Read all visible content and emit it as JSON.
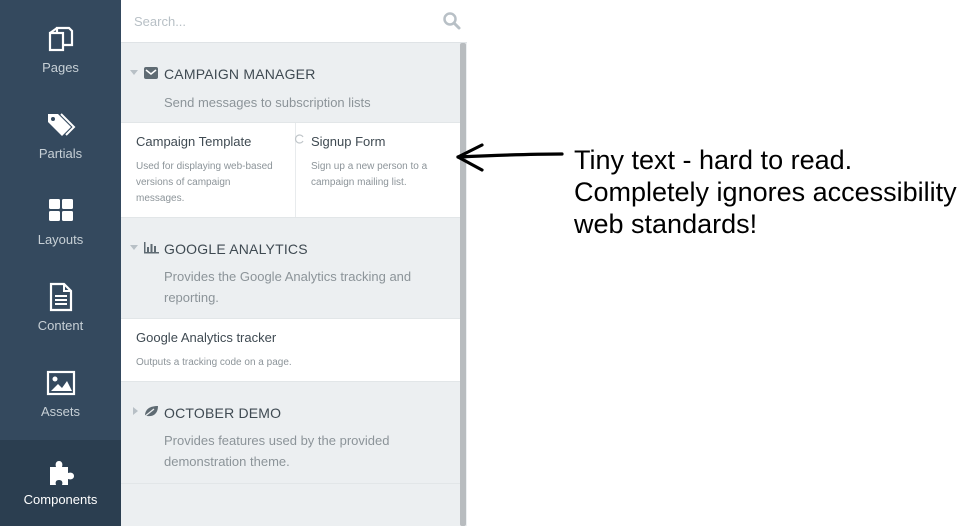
{
  "nav": {
    "items": [
      {
        "label": "Pages",
        "icon": "pages-icon"
      },
      {
        "label": "Partials",
        "icon": "tag-icon"
      },
      {
        "label": "Layouts",
        "icon": "grid-icon"
      },
      {
        "label": "Content",
        "icon": "file-icon"
      },
      {
        "label": "Assets",
        "icon": "image-icon"
      },
      {
        "label": "Components",
        "icon": "puzzle-icon",
        "active": true
      }
    ]
  },
  "search": {
    "placeholder": "Search..."
  },
  "groups": [
    {
      "title": "CAMPAIGN MANAGER",
      "icon": "envelope-icon",
      "expanded": true,
      "description": "Send messages to subscription lists",
      "components": [
        {
          "name": "Campaign Template",
          "description_lines": [
            "Used for displaying web-based",
            "versions of campaign",
            "messages."
          ]
        },
        {
          "name": "Signup Form",
          "description_lines": [
            "Sign up a new person to a",
            "campaign mailing list."
          ]
        }
      ]
    },
    {
      "title": "GOOGLE ANALYTICS",
      "icon": "bar-chart-icon",
      "expanded": true,
      "description_lines": [
        "Provides the Google Analytics tracking and",
        "reporting."
      ],
      "components": [
        {
          "name": "Google Analytics tracker",
          "description_lines": [
            "Outputs a tracking code on a page."
          ]
        }
      ]
    },
    {
      "title": "OCTOBER DEMO",
      "icon": "leaf-icon",
      "expanded": false,
      "description_lines": [
        "Provides features used by the provided",
        "demonstration theme."
      ]
    }
  ],
  "annotation": {
    "lines": [
      "Tiny text - hard to read.",
      "Completely ignores accessibility",
      "web standards!"
    ]
  },
  "colors": {
    "nav_bg": "#34495e",
    "nav_active_bg": "#2b3e50",
    "panel_bg": "#eceff1",
    "row_bg": "#ffffff",
    "text_dark": "#3f4a52",
    "text_muted": "#8c9499"
  }
}
